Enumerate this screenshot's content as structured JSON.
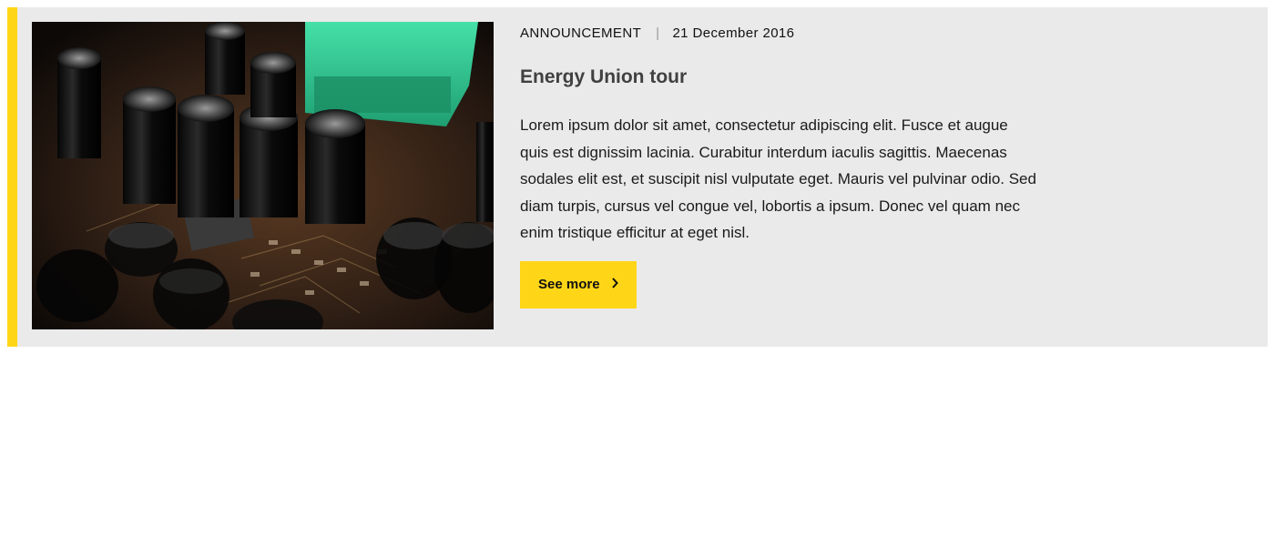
{
  "card": {
    "image_alt": "Circuit board with capacitors",
    "category": "ANNOUNCEMENT",
    "date": "21 December 2016",
    "title": "Energy Union tour",
    "description": "Lorem ipsum dolor sit amet, consectetur adipiscing elit. Fusce et augue quis est dignissim lacinia. Curabitur interdum iaculis sagittis. Maecenas sodales elit est, et suscipit nisl vulputate eget. Mauris vel pulvinar odio. Sed diam turpis, cursus vel congue vel, lobortis a ipsum. Donec vel quam nec enim tristique efficitur at eget nisl.",
    "cta_label": "See more",
    "cta_icon": "chevron-right-icon"
  },
  "colors": {
    "accent": "#ffd617",
    "card_background": "#eaeaea",
    "title": "#404040"
  }
}
